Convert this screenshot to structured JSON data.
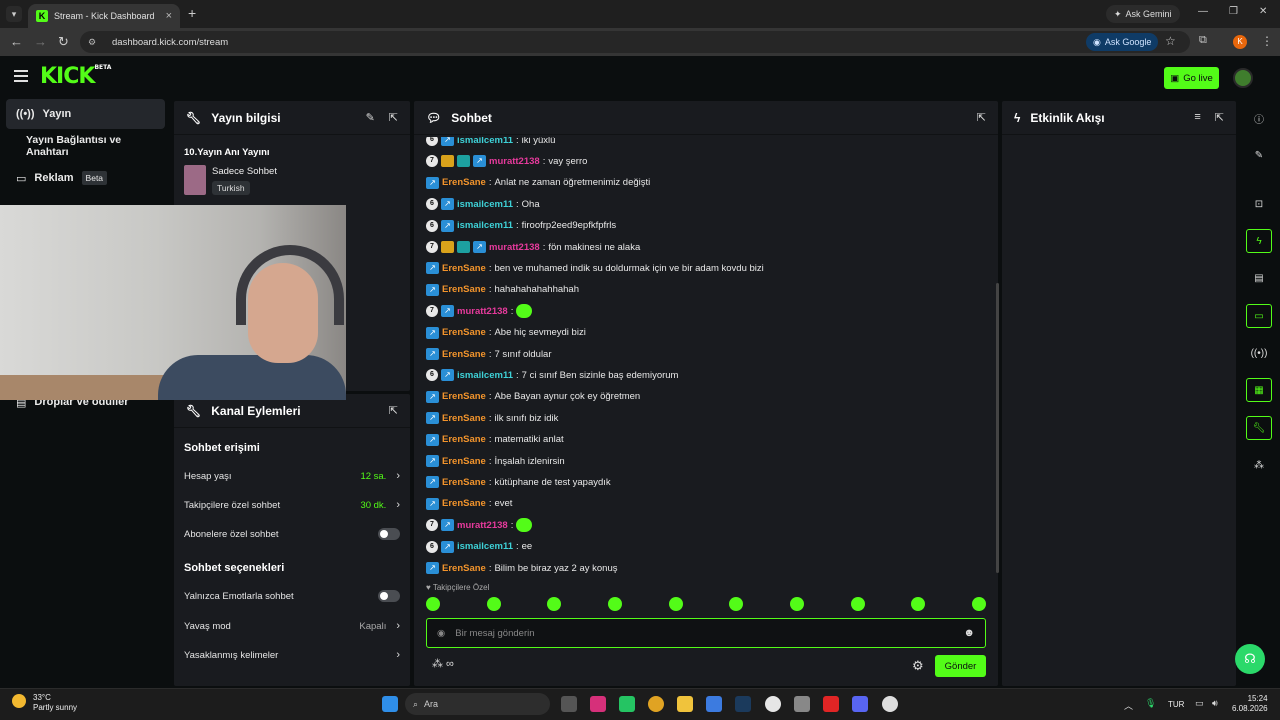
{
  "browser": {
    "tab_title": "Stream - Kick Dashboard",
    "gemini": "Ask Gemini",
    "url": "dashboard.kick.com/stream",
    "ask_google": "Ask Google",
    "profile_initial": "K"
  },
  "header": {
    "logo": "KICK",
    "logo_beta": "BETA",
    "go_live": "Go live"
  },
  "sidebar": {
    "items": [
      {
        "label": "Yayın",
        "active": true
      },
      {
        "label": "Yayın Bağlantısı ve Anahtarı"
      },
      {
        "label": "Reklam",
        "badge": "Beta"
      },
      {
        "label": "Droplar ve ödüller"
      }
    ]
  },
  "info_panel": {
    "title": "Yayın bilgisi",
    "stream_title": "10.Yayın Anı Yayını",
    "category": "Sadece Sohbet",
    "language": "Turkish"
  },
  "kanal_panel": {
    "title": "Kanal Eylemleri",
    "chat_access": "Sohbet erişimi",
    "rows": [
      {
        "label": "Hesap yaşı",
        "value": "12 sa."
      },
      {
        "label": "Takipçilere özel sohbet",
        "value": "30 dk."
      },
      {
        "label": "Abonelere özel sohbet"
      }
    ],
    "chat_options": "Sohbet seçenekleri",
    "rows2": [
      {
        "label": "Yalnızca Emotlarla sohbet"
      },
      {
        "label": "Yavaş mod",
        "value": "Kapalı"
      },
      {
        "label": "Yasaklanmış kelimeler"
      }
    ]
  },
  "chat": {
    "title": "Sohbet",
    "messages": [
      {
        "badges": [
          "6",
          "verified"
        ],
        "user": "ismailcem11",
        "color": "blue",
        "text": "iki yüxlü"
      },
      {
        "badges": [
          "7",
          "crown",
          "gift",
          "verified"
        ],
        "user": "muratt2138",
        "color": "pink",
        "text": "vay şerro"
      },
      {
        "badges": [
          "verified"
        ],
        "user": "ErenSane",
        "color": "orange",
        "text": "Anlat ne zaman öğretmenimiz değişti"
      },
      {
        "badges": [
          "6",
          "verified"
        ],
        "user": "ismailcem11",
        "color": "blue",
        "text": "Oha"
      },
      {
        "badges": [
          "6",
          "verified"
        ],
        "user": "ismailcem11",
        "color": "blue",
        "text": "firoofrp2eed9epfkfpfrls"
      },
      {
        "badges": [
          "7",
          "crown",
          "gift",
          "verified"
        ],
        "user": "muratt2138",
        "color": "pink",
        "text": "fön makinesi ne alaka"
      },
      {
        "badges": [
          "verified"
        ],
        "user": "ErenSane",
        "color": "orange",
        "text": "ben ve muhamed indik su doldurmak için ve bir adam kovdu bizi"
      },
      {
        "badges": [
          "verified"
        ],
        "user": "ErenSane",
        "color": "orange",
        "text": "hahahahahahhahah"
      },
      {
        "badges": [
          "7",
          "verified"
        ],
        "user": "muratt2138",
        "color": "pink",
        "text": "",
        "emote": true
      },
      {
        "badges": [
          "verified"
        ],
        "user": "ErenSane",
        "color": "orange",
        "text": "Abe hiç sevmeydi bizi"
      },
      {
        "badges": [
          "verified"
        ],
        "user": "ErenSane",
        "color": "orange",
        "text": "7 sınıf oldular"
      },
      {
        "badges": [
          "6",
          "verified"
        ],
        "user": "ismailcem11",
        "color": "blue",
        "text": "7 ci sınıf Ben sizinle baş edemiyorum"
      },
      {
        "badges": [
          "verified"
        ],
        "user": "ErenSane",
        "color": "orange",
        "text": "Abe Bayan aynur çok ey öğretmen"
      },
      {
        "badges": [
          "verified"
        ],
        "user": "ErenSane",
        "color": "orange",
        "text": "ilk sınıfı biz idik"
      },
      {
        "badges": [
          "verified"
        ],
        "user": "ErenSane",
        "color": "orange",
        "text": "matematiki anlat"
      },
      {
        "badges": [
          "verified"
        ],
        "user": "ErenSane",
        "color": "orange",
        "text": "İnşalah izlenirsin"
      },
      {
        "badges": [
          "verified"
        ],
        "user": "ErenSane",
        "color": "orange",
        "text": "kütüphane de test yapaydık"
      },
      {
        "badges": [
          "verified"
        ],
        "user": "ErenSane",
        "color": "orange",
        "text": "evet"
      },
      {
        "badges": [
          "7",
          "verified"
        ],
        "user": "muratt2138",
        "color": "pink",
        "text": "",
        "emote": true
      },
      {
        "badges": [
          "6",
          "verified"
        ],
        "user": "ismailcem11",
        "color": "blue",
        "text": "ee"
      },
      {
        "badges": [
          "verified"
        ],
        "user": "ErenSane",
        "color": "orange",
        "text": "Bilim be biraz yaz 2 ay konuş"
      }
    ],
    "followers_only": "Takipçilere Özel",
    "input_placeholder": "Bir mesaj gönderin",
    "send": "Gönder"
  },
  "activity": {
    "title": "Etkinlik Akışı"
  },
  "taskbar": {
    "temp": "33°C",
    "weather": "Partly sunny",
    "search": "Ara",
    "lang": "TUR",
    "time": "15:24",
    "date": "6.08.2026"
  },
  "colors": {
    "accent": "#53fc18",
    "panel": "#191b1f",
    "bg": "#0b0e0f"
  }
}
